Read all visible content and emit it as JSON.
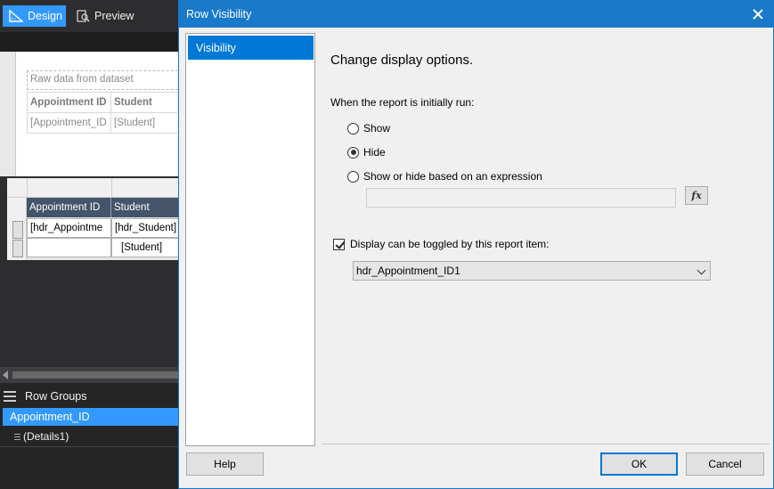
{
  "designer": {
    "tabs": [
      {
        "label": "Design",
        "icon": "ruler-icon",
        "active": true
      },
      {
        "label": "Preview",
        "icon": "preview-icon",
        "active": false
      }
    ],
    "textbox": "Raw data from dataset",
    "table1": {
      "headers": [
        "Appointment ID",
        "Student"
      ],
      "row": [
        "[Appointment_ID",
        "[Student]"
      ]
    },
    "table2": {
      "headers": [
        "Appointment ID",
        "Student"
      ],
      "row1": [
        "[hdr_Appointme",
        "[hdr_Student]"
      ],
      "row2": [
        "",
        "[Student]"
      ]
    },
    "row_groups": {
      "title": "Row Groups",
      "items": [
        "Appointment_ID",
        "(Details1)"
      ]
    }
  },
  "dialog": {
    "title": "Row Visibility",
    "nav": [
      "Visibility"
    ],
    "heading": "Change display options.",
    "question": "When the report is initially run:",
    "options": [
      {
        "label": "Show",
        "selected": false
      },
      {
        "label": "Hide",
        "selected": true
      },
      {
        "label": "Show or hide based on an expression",
        "selected": false
      }
    ],
    "expression": "",
    "fx_label": "fx",
    "toggle": {
      "label": "Display can be toggled by this report item:",
      "checked": true,
      "value": "hdr_Appointment_ID1"
    },
    "buttons": {
      "help": "Help",
      "ok": "OK",
      "cancel": "Cancel"
    }
  },
  "colors": {
    "accent": "#1979ca",
    "selection": "#0078d7",
    "header_cell": "#44546a",
    "ide_dark": "#2d2d30"
  }
}
